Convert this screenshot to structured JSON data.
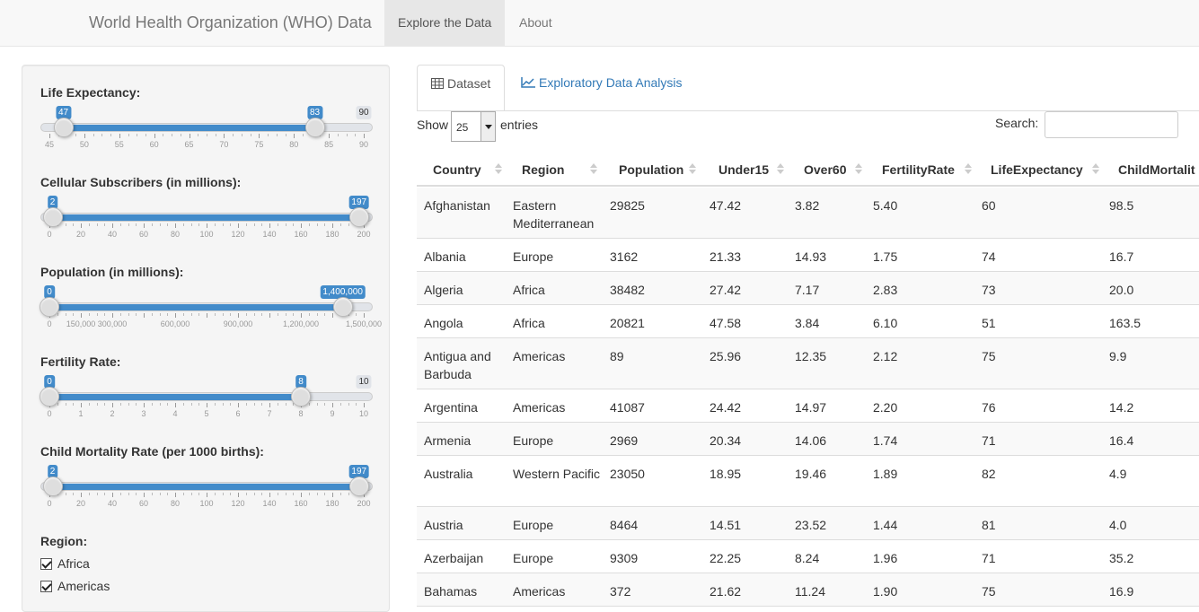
{
  "navbar": {
    "brand": "World Health Organization (WHO) Data",
    "tabs": [
      {
        "label": "Explore the Data",
        "active": true
      },
      {
        "label": "About",
        "active": false
      }
    ]
  },
  "sidebar": {
    "sliders": [
      {
        "label": "Life Expectancy:",
        "min": 45,
        "max": 90,
        "from": 47,
        "to": 83,
        "from_label": "47",
        "to_label": "83",
        "max_label": "90",
        "min_label": "",
        "ticks": [
          "45",
          "50",
          "55",
          "60",
          "65",
          "70",
          "75",
          "80",
          "85",
          "90"
        ]
      },
      {
        "label": "Cellular Subscribers (in millions):",
        "min": 0,
        "max": 200,
        "from": 2,
        "to": 197,
        "from_label": "2",
        "to_label": "197",
        "max_label": "",
        "min_label": "",
        "ticks": [
          "0",
          "20",
          "40",
          "60",
          "80",
          "100",
          "120",
          "140",
          "160",
          "180",
          "200"
        ]
      },
      {
        "label": "Population (in millions):",
        "min": 0,
        "max": 1500000,
        "from": 0,
        "to": 1400000,
        "from_label": "0",
        "to_label": "1,400,000",
        "max_label": "",
        "min_label": "",
        "ticks": [
          "0",
          "150,000",
          "300,000",
          "",
          "600,000",
          "",
          "900,000",
          "",
          "1,200,000",
          "",
          "1,500,000"
        ]
      },
      {
        "label": "Fertility Rate:",
        "min": 0,
        "max": 10,
        "from": 0,
        "to": 8,
        "from_label": "0",
        "to_label": "8",
        "max_label": "10",
        "min_label": "",
        "ticks": [
          "0",
          "1",
          "2",
          "3",
          "4",
          "5",
          "6",
          "7",
          "8",
          "9",
          "10"
        ]
      },
      {
        "label": "Child Mortality Rate (per 1000 births):",
        "min": 0,
        "max": 200,
        "from": 2,
        "to": 197,
        "from_label": "2",
        "to_label": "197",
        "max_label": "",
        "min_label": "",
        "ticks": [
          "0",
          "20",
          "40",
          "60",
          "80",
          "100",
          "120",
          "140",
          "160",
          "180",
          "200"
        ]
      }
    ],
    "region_label": "Region:",
    "regions": [
      {
        "label": "Africa",
        "checked": true
      },
      {
        "label": "Americas",
        "checked": true
      }
    ]
  },
  "main": {
    "tabs": [
      {
        "label": "Dataset",
        "icon": "table-icon",
        "active": true
      },
      {
        "label": "Exploratory Data Analysis",
        "icon": "line-chart-icon",
        "active": false
      }
    ],
    "show_label": "Show",
    "entries_value": "25",
    "entries_label": "entries",
    "search_label": "Search:",
    "search_value": ""
  },
  "table": {
    "columns": [
      "Country",
      "Region",
      "Population",
      "Under15",
      "Over60",
      "FertilityRate",
      "LifeExpectancy",
      "ChildMortalit"
    ],
    "rows": [
      [
        "Afghanistan",
        "Eastern Mediterranean",
        "29825",
        "47.42",
        "3.82",
        "5.40",
        "60",
        "98.5"
      ],
      [
        "Albania",
        "Europe",
        "3162",
        "21.33",
        "14.93",
        "1.75",
        "74",
        "16.7"
      ],
      [
        "Algeria",
        "Africa",
        "38482",
        "27.42",
        "7.17",
        "2.83",
        "73",
        "20.0"
      ],
      [
        "Angola",
        "Africa",
        "20821",
        "47.58",
        "3.84",
        "6.10",
        "51",
        "163.5"
      ],
      [
        "Antigua and Barbuda",
        "Americas",
        "89",
        "25.96",
        "12.35",
        "2.12",
        "75",
        "9.9"
      ],
      [
        "Argentina",
        "Americas",
        "41087",
        "24.42",
        "14.97",
        "2.20",
        "76",
        "14.2"
      ],
      [
        "Armenia",
        "Europe",
        "2969",
        "20.34",
        "14.06",
        "1.74",
        "71",
        "16.4"
      ],
      [
        "Australia",
        "Western Pacific",
        "23050",
        "18.95",
        "19.46",
        "1.89",
        "82",
        "4.9"
      ],
      [
        "Austria",
        "Europe",
        "8464",
        "14.51",
        "23.52",
        "1.44",
        "81",
        "4.0"
      ],
      [
        "Azerbaijan",
        "Europe",
        "9309",
        "22.25",
        "8.24",
        "1.96",
        "71",
        "35.2"
      ],
      [
        "Bahamas",
        "Americas",
        "372",
        "21.62",
        "11.24",
        "1.90",
        "75",
        "16.9"
      ]
    ]
  },
  "colors": {
    "accent": "#428bca",
    "link": "#337ab7",
    "navbar_bg": "#f8f8f8",
    "sidebar_bg": "#f5f5f5"
  }
}
